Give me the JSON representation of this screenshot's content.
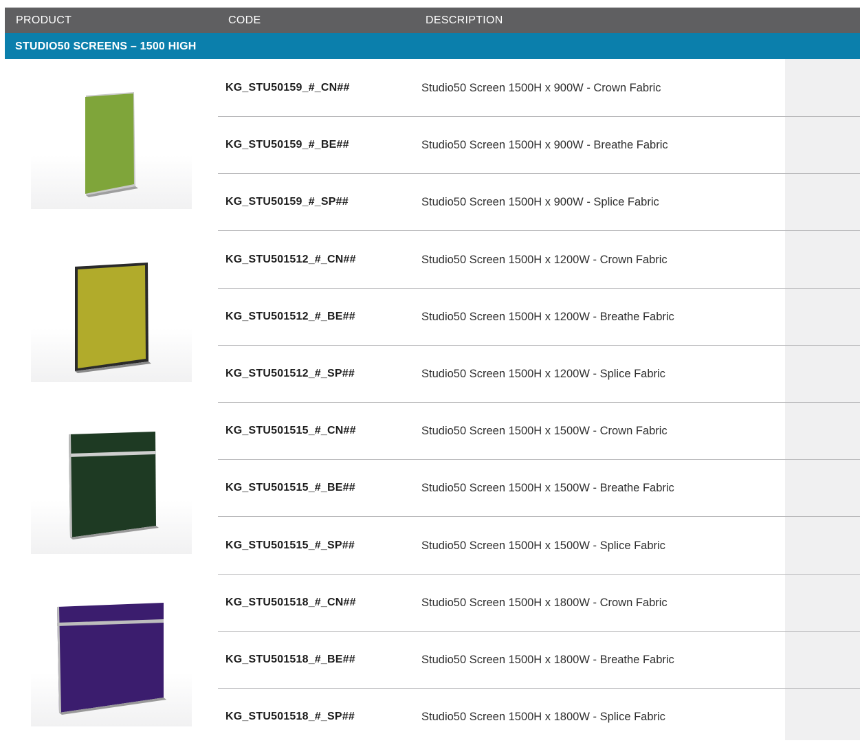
{
  "header": {
    "product": "PRODUCT",
    "code": "CODE",
    "description": "DESCRIPTION"
  },
  "section": {
    "title": "STUDIO50 SCREENS – 1500 HIGH"
  },
  "products": [
    {
      "color": "#7fa53a",
      "rows": [
        {
          "code": "KG_STU50159_#_CN##",
          "description": "Studio50 Screen 1500H x 900W - Crown Fabric"
        },
        {
          "code": "KG_STU50159_#_BE##",
          "description": "Studio50 Screen 1500H x 900W - Breathe Fabric"
        },
        {
          "code": "KG_STU50159_#_SP##",
          "description": "Studio50 Screen 1500H x 900W - Splice Fabric"
        }
      ]
    },
    {
      "color": "#b1ab2b",
      "rows": [
        {
          "code": "KG_STU501512_#_CN##",
          "description": "Studio50 Screen 1500H x 1200W - Crown Fabric"
        },
        {
          "code": "KG_STU501512_#_BE##",
          "description": "Studio50 Screen 1500H x 1200W - Breathe Fabric"
        },
        {
          "code": "KG_STU501512_#_SP##",
          "description": "Studio50 Screen 1500H x 1200W - Splice Fabric"
        }
      ]
    },
    {
      "color": "#1e3a23",
      "rows": [
        {
          "code": "KG_STU501515_#_CN##",
          "description": "Studio50 Screen 1500H x 1500W - Crown Fabric"
        },
        {
          "code": "KG_STU501515_#_BE##",
          "description": "Studio50 Screen 1500H x 1500W - Breathe Fabric"
        },
        {
          "code": "KG_STU501515_#_SP##",
          "description": "Studio50 Screen 1500H x 1500W - Splice Fabric"
        }
      ]
    },
    {
      "color": "#3b1d6e",
      "rows": [
        {
          "code": "KG_STU501518_#_CN##",
          "description": "Studio50 Screen 1500H x 1800W - Crown Fabric"
        },
        {
          "code": "KG_STU501518_#_BE##",
          "description": "Studio50 Screen 1500H x 1800W - Breathe Fabric"
        },
        {
          "code": "KG_STU501518_#_SP##",
          "description": "Studio50 Screen 1500H x 1800W - Splice Fabric"
        }
      ]
    }
  ]
}
